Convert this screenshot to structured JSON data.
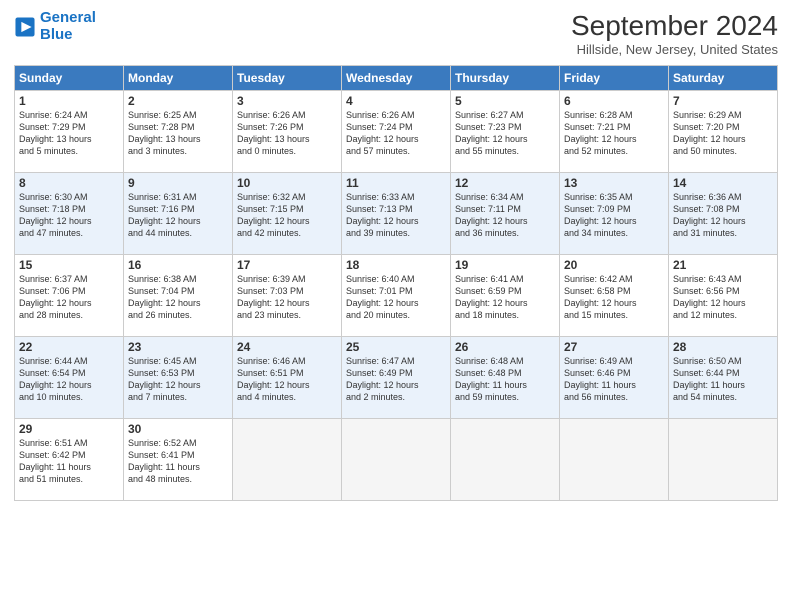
{
  "header": {
    "logo_line1": "General",
    "logo_line2": "Blue",
    "month": "September 2024",
    "location": "Hillside, New Jersey, United States"
  },
  "days_of_week": [
    "Sunday",
    "Monday",
    "Tuesday",
    "Wednesday",
    "Thursday",
    "Friday",
    "Saturday"
  ],
  "weeks": [
    [
      {
        "day": "1",
        "lines": [
          "Sunrise: 6:24 AM",
          "Sunset: 7:29 PM",
          "Daylight: 13 hours",
          "and 5 minutes."
        ]
      },
      {
        "day": "2",
        "lines": [
          "Sunrise: 6:25 AM",
          "Sunset: 7:28 PM",
          "Daylight: 13 hours",
          "and 3 minutes."
        ]
      },
      {
        "day": "3",
        "lines": [
          "Sunrise: 6:26 AM",
          "Sunset: 7:26 PM",
          "Daylight: 13 hours",
          "and 0 minutes."
        ]
      },
      {
        "day": "4",
        "lines": [
          "Sunrise: 6:26 AM",
          "Sunset: 7:24 PM",
          "Daylight: 12 hours",
          "and 57 minutes."
        ]
      },
      {
        "day": "5",
        "lines": [
          "Sunrise: 6:27 AM",
          "Sunset: 7:23 PM",
          "Daylight: 12 hours",
          "and 55 minutes."
        ]
      },
      {
        "day": "6",
        "lines": [
          "Sunrise: 6:28 AM",
          "Sunset: 7:21 PM",
          "Daylight: 12 hours",
          "and 52 minutes."
        ]
      },
      {
        "day": "7",
        "lines": [
          "Sunrise: 6:29 AM",
          "Sunset: 7:20 PM",
          "Daylight: 12 hours",
          "and 50 minutes."
        ]
      }
    ],
    [
      {
        "day": "8",
        "lines": [
          "Sunrise: 6:30 AM",
          "Sunset: 7:18 PM",
          "Daylight: 12 hours",
          "and 47 minutes."
        ]
      },
      {
        "day": "9",
        "lines": [
          "Sunrise: 6:31 AM",
          "Sunset: 7:16 PM",
          "Daylight: 12 hours",
          "and 44 minutes."
        ]
      },
      {
        "day": "10",
        "lines": [
          "Sunrise: 6:32 AM",
          "Sunset: 7:15 PM",
          "Daylight: 12 hours",
          "and 42 minutes."
        ]
      },
      {
        "day": "11",
        "lines": [
          "Sunrise: 6:33 AM",
          "Sunset: 7:13 PM",
          "Daylight: 12 hours",
          "and 39 minutes."
        ]
      },
      {
        "day": "12",
        "lines": [
          "Sunrise: 6:34 AM",
          "Sunset: 7:11 PM",
          "Daylight: 12 hours",
          "and 36 minutes."
        ]
      },
      {
        "day": "13",
        "lines": [
          "Sunrise: 6:35 AM",
          "Sunset: 7:09 PM",
          "Daylight: 12 hours",
          "and 34 minutes."
        ]
      },
      {
        "day": "14",
        "lines": [
          "Sunrise: 6:36 AM",
          "Sunset: 7:08 PM",
          "Daylight: 12 hours",
          "and 31 minutes."
        ]
      }
    ],
    [
      {
        "day": "15",
        "lines": [
          "Sunrise: 6:37 AM",
          "Sunset: 7:06 PM",
          "Daylight: 12 hours",
          "and 28 minutes."
        ]
      },
      {
        "day": "16",
        "lines": [
          "Sunrise: 6:38 AM",
          "Sunset: 7:04 PM",
          "Daylight: 12 hours",
          "and 26 minutes."
        ]
      },
      {
        "day": "17",
        "lines": [
          "Sunrise: 6:39 AM",
          "Sunset: 7:03 PM",
          "Daylight: 12 hours",
          "and 23 minutes."
        ]
      },
      {
        "day": "18",
        "lines": [
          "Sunrise: 6:40 AM",
          "Sunset: 7:01 PM",
          "Daylight: 12 hours",
          "and 20 minutes."
        ]
      },
      {
        "day": "19",
        "lines": [
          "Sunrise: 6:41 AM",
          "Sunset: 6:59 PM",
          "Daylight: 12 hours",
          "and 18 minutes."
        ]
      },
      {
        "day": "20",
        "lines": [
          "Sunrise: 6:42 AM",
          "Sunset: 6:58 PM",
          "Daylight: 12 hours",
          "and 15 minutes."
        ]
      },
      {
        "day": "21",
        "lines": [
          "Sunrise: 6:43 AM",
          "Sunset: 6:56 PM",
          "Daylight: 12 hours",
          "and 12 minutes."
        ]
      }
    ],
    [
      {
        "day": "22",
        "lines": [
          "Sunrise: 6:44 AM",
          "Sunset: 6:54 PM",
          "Daylight: 12 hours",
          "and 10 minutes."
        ]
      },
      {
        "day": "23",
        "lines": [
          "Sunrise: 6:45 AM",
          "Sunset: 6:53 PM",
          "Daylight: 12 hours",
          "and 7 minutes."
        ]
      },
      {
        "day": "24",
        "lines": [
          "Sunrise: 6:46 AM",
          "Sunset: 6:51 PM",
          "Daylight: 12 hours",
          "and 4 minutes."
        ]
      },
      {
        "day": "25",
        "lines": [
          "Sunrise: 6:47 AM",
          "Sunset: 6:49 PM",
          "Daylight: 12 hours",
          "and 2 minutes."
        ]
      },
      {
        "day": "26",
        "lines": [
          "Sunrise: 6:48 AM",
          "Sunset: 6:48 PM",
          "Daylight: 11 hours",
          "and 59 minutes."
        ]
      },
      {
        "day": "27",
        "lines": [
          "Sunrise: 6:49 AM",
          "Sunset: 6:46 PM",
          "Daylight: 11 hours",
          "and 56 minutes."
        ]
      },
      {
        "day": "28",
        "lines": [
          "Sunrise: 6:50 AM",
          "Sunset: 6:44 PM",
          "Daylight: 11 hours",
          "and 54 minutes."
        ]
      }
    ],
    [
      {
        "day": "29",
        "lines": [
          "Sunrise: 6:51 AM",
          "Sunset: 6:42 PM",
          "Daylight: 11 hours",
          "and 51 minutes."
        ]
      },
      {
        "day": "30",
        "lines": [
          "Sunrise: 6:52 AM",
          "Sunset: 6:41 PM",
          "Daylight: 11 hours",
          "and 48 minutes."
        ]
      },
      null,
      null,
      null,
      null,
      null
    ]
  ]
}
